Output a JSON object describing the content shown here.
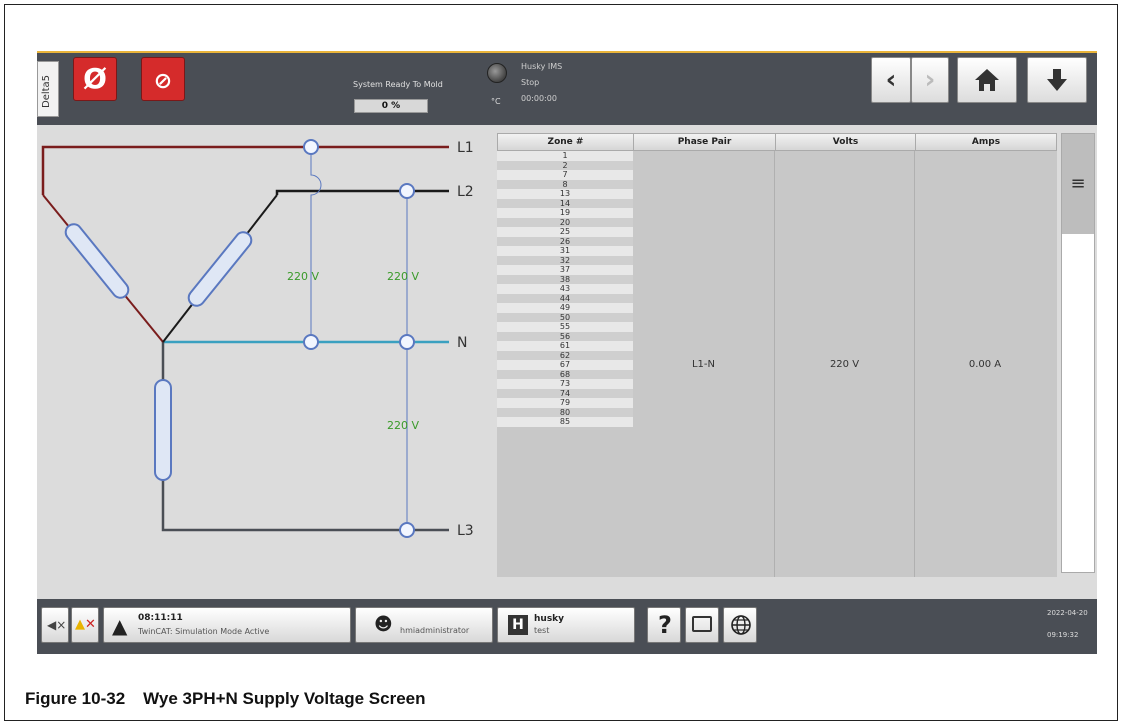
{
  "topbar": {
    "side_tab": "Delta5",
    "ready_label": "System Ready To Mold",
    "progress_value": "0 %",
    "progress_fraction": 0,
    "temp_unit": "°C",
    "status_line1": "Husky IMS",
    "status_line2": "Stop",
    "status_line3": "00:00:00"
  },
  "diagram": {
    "lines": [
      "L1",
      "L2",
      "N",
      "L3"
    ],
    "voltage_l1_n": "220 V",
    "voltage_l2_n": "220 V",
    "voltage_n_l3": "220 V"
  },
  "table": {
    "headers": [
      "Zone #",
      "Phase Pair",
      "Volts",
      "Amps"
    ],
    "zones": [
      "1",
      "2",
      "7",
      "8",
      "13",
      "14",
      "19",
      "20",
      "25",
      "26",
      "31",
      "32",
      "37",
      "38",
      "43",
      "44",
      "49",
      "50",
      "55",
      "56",
      "61",
      "62",
      "67",
      "68",
      "73",
      "74",
      "79",
      "80",
      "85"
    ],
    "phase_pair": "L1-N",
    "volts": "220 V",
    "amps": "0.00 A"
  },
  "bottombar": {
    "alarm_time": "08:11:11",
    "alarm_text": "TwinCAT: Simulation Mode Active",
    "user": "hmiadministrator",
    "brand_line1": "husky",
    "brand_line2": "test",
    "help": "?",
    "date": "2022-04-20",
    "time": "09:19:32"
  },
  "caption": {
    "number": "Figure 10-32",
    "title": "Wye 3PH+N Supply Voltage Screen"
  },
  "colors": {
    "l1": "#7a1d1d",
    "l2": "#1a1a1a",
    "n": "#3aa0c0",
    "l3": "#4a4e55",
    "voltage_text": "#3a9a2a",
    "accent": "#d52b2b"
  }
}
